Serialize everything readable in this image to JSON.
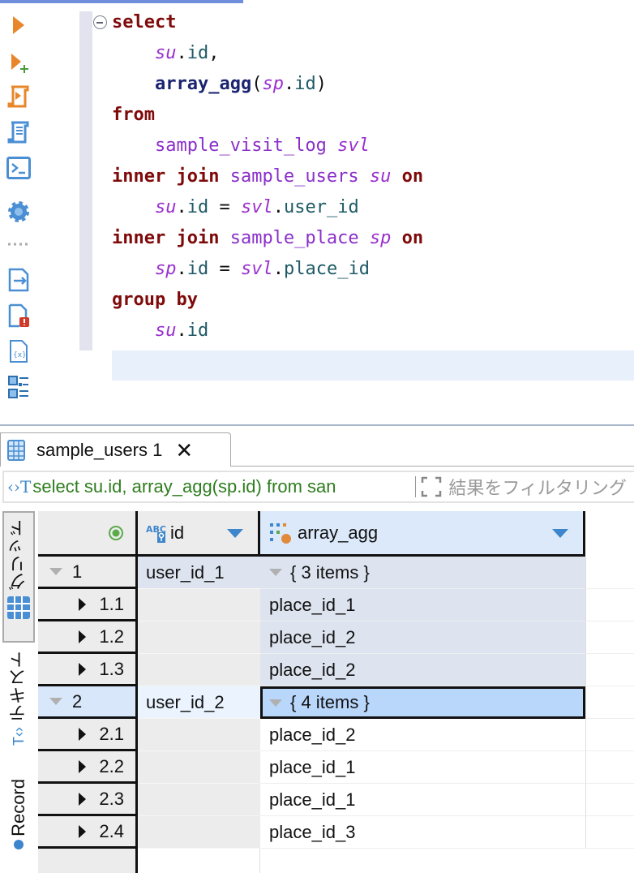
{
  "toolbar": {
    "icons": [
      "execute-statement-icon",
      "execute-in-new-tab-icon",
      "execute-script-icon",
      "execute-script-new-tab-icon",
      "console-icon",
      "settings-icon",
      "separator",
      "export-icon",
      "error-log-icon",
      "variables-icon",
      "outline-icon"
    ]
  },
  "editor": {
    "lines": [
      [
        [
          "kw",
          "select"
        ]
      ],
      [
        [
          "pl",
          "    "
        ],
        [
          "al",
          "su"
        ],
        [
          "pl",
          "."
        ],
        [
          "col",
          "id"
        ],
        [
          "pl",
          ","
        ]
      ],
      [
        [
          "pl",
          "    "
        ],
        [
          "fn",
          "array_agg"
        ],
        [
          "pl",
          "("
        ],
        [
          "al",
          "sp"
        ],
        [
          "pl",
          "."
        ],
        [
          "col",
          "id"
        ],
        [
          "pl",
          ")"
        ]
      ],
      [
        [
          "kw",
          "from"
        ]
      ],
      [
        [
          "pl",
          "    "
        ],
        [
          "tbl",
          "sample_visit_log "
        ],
        [
          "al",
          "svl"
        ]
      ],
      [
        [
          "kw",
          "inner join "
        ],
        [
          "tbl",
          "sample_users "
        ],
        [
          "al",
          "su"
        ],
        [
          "kw",
          " on"
        ]
      ],
      [
        [
          "pl",
          "    "
        ],
        [
          "al",
          "su"
        ],
        [
          "pl",
          "."
        ],
        [
          "col",
          "id"
        ],
        [
          "pl",
          " = "
        ],
        [
          "al",
          "svl"
        ],
        [
          "pl",
          "."
        ],
        [
          "col",
          "user_id"
        ]
      ],
      [
        [
          "kw",
          "inner join "
        ],
        [
          "tbl",
          "sample_place "
        ],
        [
          "al",
          "sp"
        ],
        [
          "kw",
          " on"
        ]
      ],
      [
        [
          "pl",
          "    "
        ],
        [
          "al",
          "sp"
        ],
        [
          "pl",
          "."
        ],
        [
          "col",
          "id"
        ],
        [
          "pl",
          " = "
        ],
        [
          "al",
          "svl"
        ],
        [
          "pl",
          "."
        ],
        [
          "col",
          "place_id"
        ]
      ],
      [
        [
          "kw",
          "group by"
        ]
      ],
      [
        [
          "pl",
          "    "
        ],
        [
          "al",
          "su"
        ],
        [
          "pl",
          "."
        ],
        [
          "col",
          "id"
        ]
      ]
    ]
  },
  "results": {
    "tab_label": "sample_users 1",
    "query_text": "select su.id, array_agg(sp.id) from san",
    "filter_placeholder": "結果をフィルタリング",
    "side_tabs": {
      "grid": "グリッド",
      "text": "テキスト",
      "record": "Record"
    },
    "columns": [
      {
        "name": "id"
      },
      {
        "name": "array_agg"
      }
    ],
    "rows": [
      {
        "num": "1",
        "id": "user_id_1",
        "agg": "{ 3 items }",
        "parent": true
      },
      {
        "num": "1.1",
        "id": "",
        "agg": "place_id_1"
      },
      {
        "num": "1.2",
        "id": "",
        "agg": "place_id_2"
      },
      {
        "num": "1.3",
        "id": "",
        "agg": "place_id_2"
      },
      {
        "num": "2",
        "id": "user_id_2",
        "agg": "{ 4 items }",
        "parent": true,
        "selected": true
      },
      {
        "num": "2.1",
        "id": "",
        "agg": "place_id_2"
      },
      {
        "num": "2.2",
        "id": "",
        "agg": "place_id_1"
      },
      {
        "num": "2.3",
        "id": "",
        "agg": "place_id_1"
      },
      {
        "num": "2.4",
        "id": "",
        "agg": "place_id_3"
      }
    ]
  }
}
